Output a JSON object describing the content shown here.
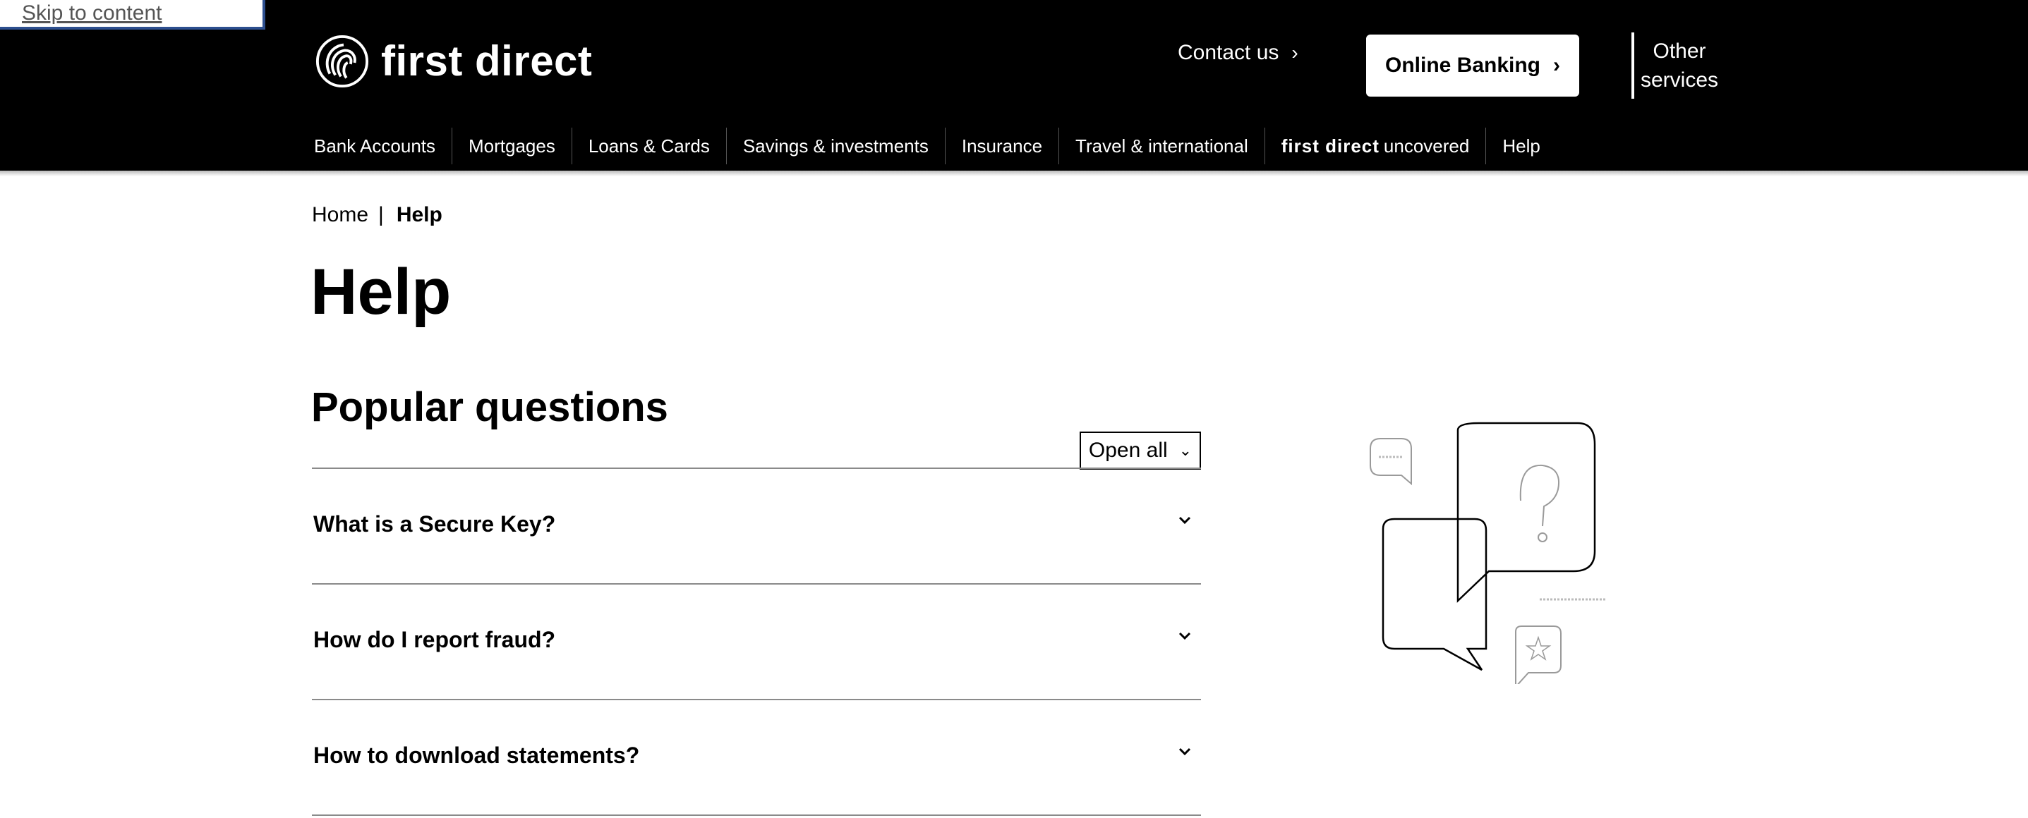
{
  "skip_link": "Skip to content",
  "brand": {
    "name": "first direct"
  },
  "header": {
    "contact": "Contact us",
    "online_banking": "Online Banking",
    "other_services": [
      "Other",
      "services"
    ]
  },
  "nav": [
    {
      "label": "Bank Accounts"
    },
    {
      "label": "Mortgages"
    },
    {
      "label": "Loans & Cards"
    },
    {
      "label": "Savings & investments"
    },
    {
      "label": "Insurance"
    },
    {
      "label": "Travel & international"
    },
    {
      "brand": "first direct",
      "label": "uncovered"
    },
    {
      "label": "Help"
    }
  ],
  "breadcrumb": {
    "home": "Home",
    "separator": "|",
    "current": "Help"
  },
  "page_title": "Help",
  "section_title": "Popular questions",
  "open_all": "Open all",
  "faqs": [
    {
      "question": "What is a Secure Key?"
    },
    {
      "question": "How do I report fraud?"
    },
    {
      "question": "How to download statements?"
    }
  ],
  "colors": {
    "header_bg": "#000000",
    "accent": "#ffffff",
    "divider": "#8a8a8a"
  }
}
